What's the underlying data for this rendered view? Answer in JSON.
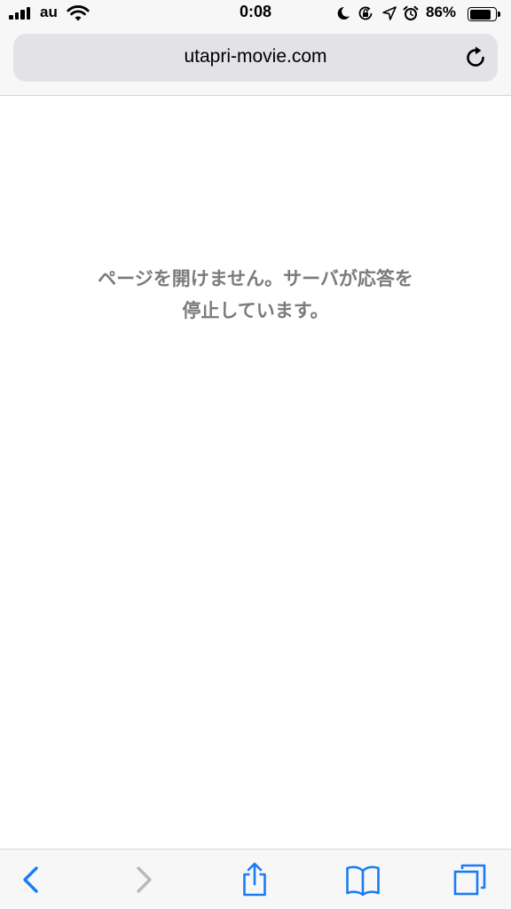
{
  "status_bar": {
    "carrier": "au",
    "time": "0:08",
    "battery_percent": "86%",
    "battery_level": 0.86,
    "icons": [
      "signal-icon",
      "wifi-icon",
      "moon-icon",
      "rotation-lock-icon",
      "location-icon",
      "alarm-icon",
      "battery-icon"
    ]
  },
  "browser": {
    "url": "utapri-movie.com",
    "reload_icon": "reload-icon"
  },
  "content": {
    "error_line1": "ページを開けません。サーバが応答を",
    "error_line2": "停止しています。"
  },
  "toolbar": {
    "icons": [
      "back-icon",
      "forward-icon",
      "share-icon",
      "bookmarks-icon",
      "tabs-icon"
    ]
  },
  "colors": {
    "accent": "#1a7cf3",
    "disabled": "#b9b9bd",
    "message_text": "#7b7b7d",
    "chrome_bg": "#f7f7f8",
    "urlbar_bg": "#e3e3e7"
  }
}
